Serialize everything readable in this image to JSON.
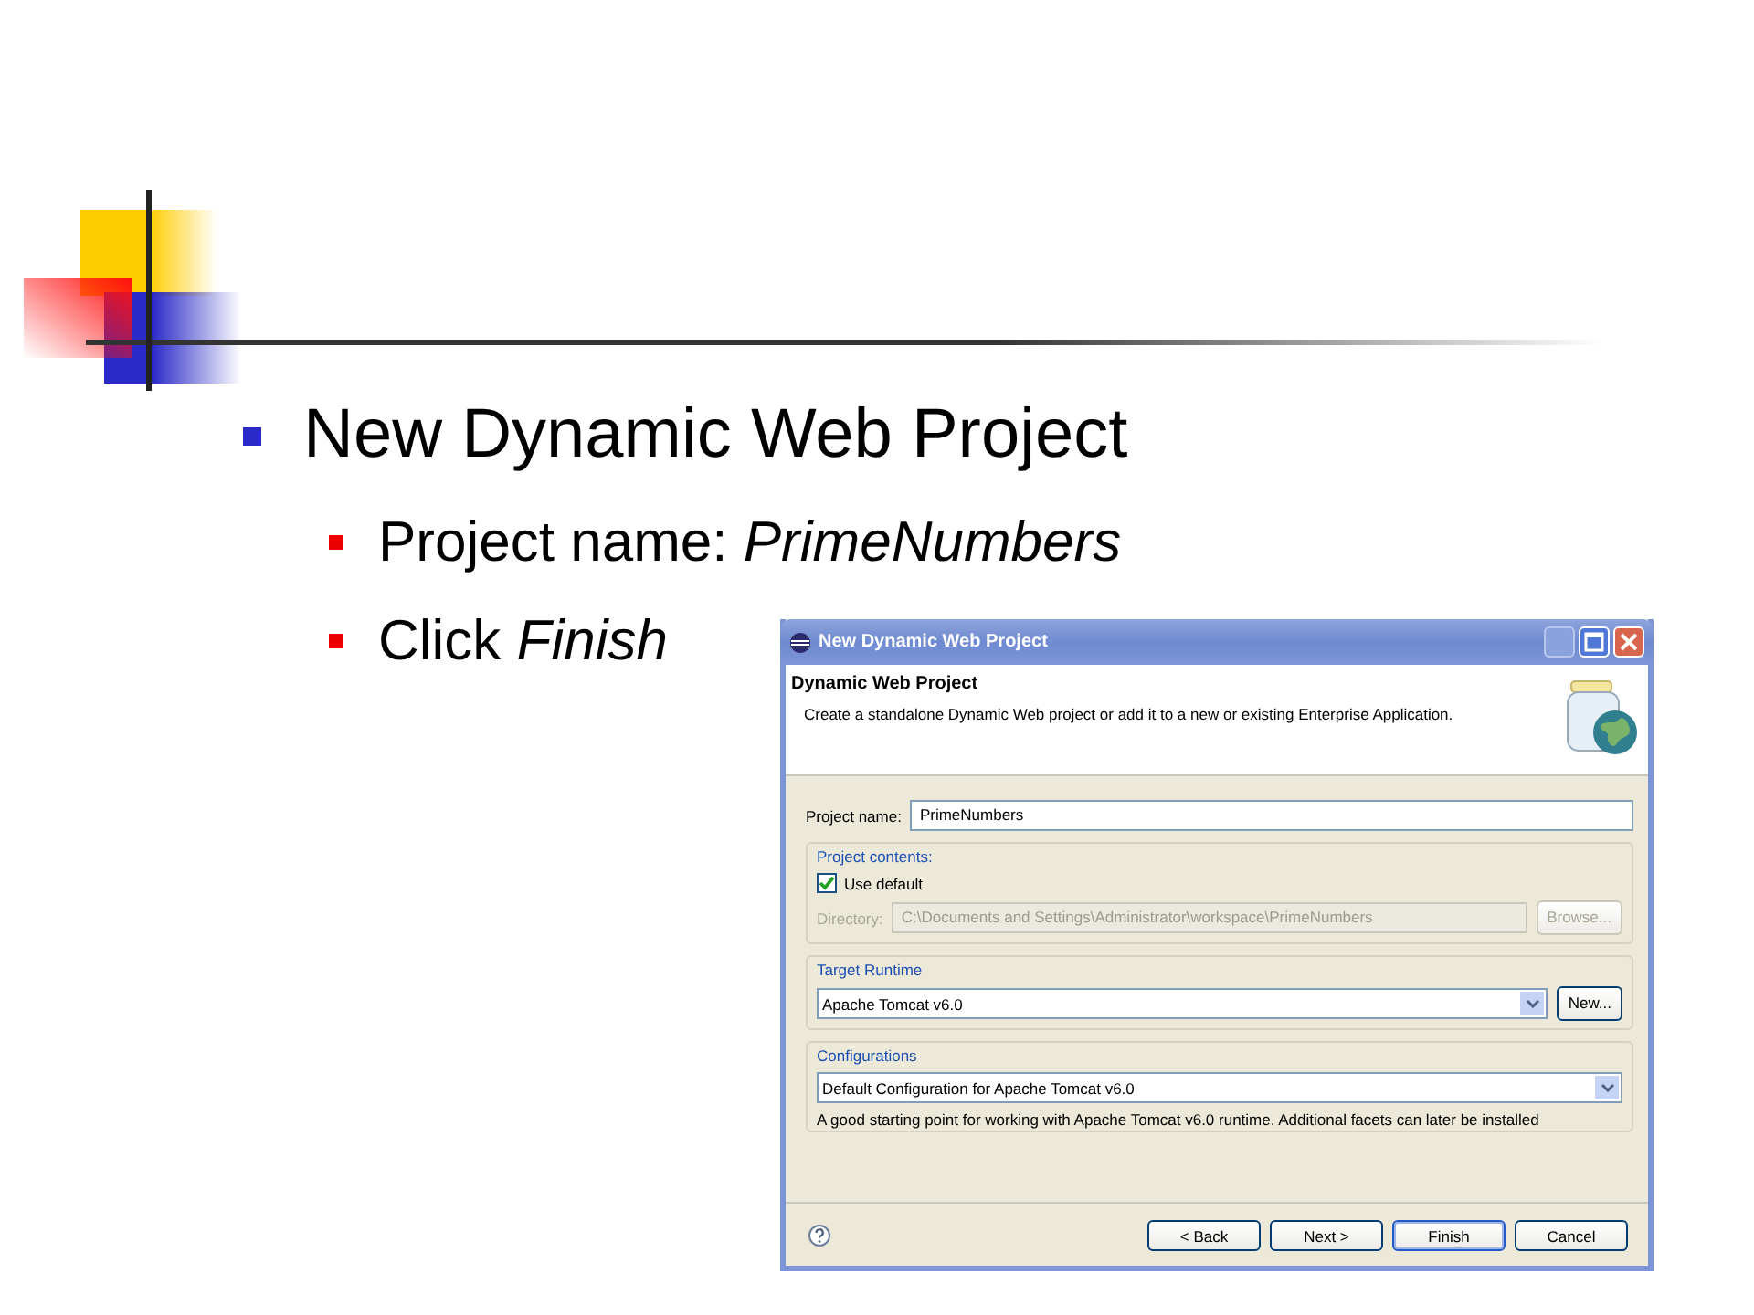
{
  "slide": {
    "bullets": [
      {
        "text": "New Dynamic Web Project",
        "children": [
          {
            "text": "Project name: *PrimeNumbers*"
          },
          {
            "text": "Click *Finish*"
          }
        ]
      }
    ]
  },
  "dialog": {
    "title": "New Dynamic Web Project",
    "header": {
      "title": "Dynamic Web Project",
      "description": "Create a standalone Dynamic Web project or add it to a new or existing Enterprise Application."
    },
    "project_name": {
      "label": "Project name:",
      "value": "PrimeNumbers"
    },
    "project_contents": {
      "legend": "Project contents:",
      "use_default": {
        "label": "Use default",
        "checked": true
      },
      "directory": {
        "label": "Directory:",
        "value": "C:\\Documents and Settings\\Administrator\\workspace\\PrimeNumbers",
        "disabled": true
      },
      "browse_button": "Browse..."
    },
    "target_runtime": {
      "legend": "Target Runtime",
      "value": "Apache Tomcat v6.0",
      "new_button": "New..."
    },
    "configurations": {
      "legend": "Configurations",
      "value": "Default Configuration for Apache Tomcat v6.0",
      "description": "A good starting point for working with Apache Tomcat v6.0 runtime. Additional facets can later be installed"
    },
    "buttons": [
      {
        "label": "< Back",
        "default": false
      },
      {
        "label": "Next >",
        "default": false
      },
      {
        "label": "Finish",
        "default": true
      },
      {
        "label": "Cancel",
        "default": false
      }
    ]
  }
}
